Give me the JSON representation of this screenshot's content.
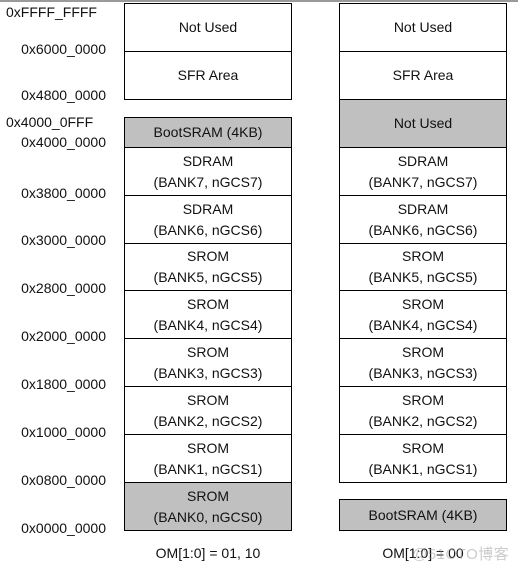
{
  "addresses": [
    "0xFFFF_FFFF",
    "0x6000_0000",
    "0x4800_0000",
    "0x4000_0FFF",
    "0x4000_0000",
    "0x3800_0000",
    "0x3000_0000",
    "0x2800_0000",
    "0x2000_0000",
    "0x1800_0000",
    "0x1000_0000",
    "0x0800_0000",
    "0x0000_0000"
  ],
  "left_map": {
    "caption": "OM[1:0] = 01, 10",
    "regions": [
      {
        "line1": "Not Used",
        "line2": "",
        "shaded": false
      },
      {
        "line1": "SFR Area",
        "line2": "",
        "shaded": false
      },
      {
        "line1": "BootSRAM (4KB)",
        "line2": "",
        "shaded": true
      },
      {
        "line1": "SDRAM",
        "line2": "(BANK7, nGCS7)",
        "shaded": false
      },
      {
        "line1": "SDRAM",
        "line2": "(BANK6, nGCS6)",
        "shaded": false
      },
      {
        "line1": "SROM",
        "line2": "(BANK5, nGCS5)",
        "shaded": false
      },
      {
        "line1": "SROM",
        "line2": "(BANK4, nGCS4)",
        "shaded": false
      },
      {
        "line1": "SROM",
        "line2": "(BANK3, nGCS3)",
        "shaded": false
      },
      {
        "line1": "SROM",
        "line2": "(BANK2, nGCS2)",
        "shaded": false
      },
      {
        "line1": "SROM",
        "line2": "(BANK1, nGCS1)",
        "shaded": false
      },
      {
        "line1": "SROM",
        "line2": "(BANK0, nGCS0)",
        "shaded": true
      }
    ]
  },
  "right_map": {
    "caption": "OM[1:0] = 00",
    "regions": [
      {
        "line1": "Not Used",
        "line2": "",
        "shaded": false
      },
      {
        "line1": "SFR Area",
        "line2": "",
        "shaded": false
      },
      {
        "line1": "Not Used",
        "line2": "",
        "shaded": true
      },
      {
        "line1": "SDRAM",
        "line2": "(BANK7, nGCS7)",
        "shaded": false
      },
      {
        "line1": "SDRAM",
        "line2": "(BANK6, nGCS6)",
        "shaded": false
      },
      {
        "line1": "SROM",
        "line2": "(BANK5, nGCS5)",
        "shaded": false
      },
      {
        "line1": "SROM",
        "line2": "(BANK4, nGCS4)",
        "shaded": false
      },
      {
        "line1": "SROM",
        "line2": "(BANK3, nGCS3)",
        "shaded": false
      },
      {
        "line1": "SROM",
        "line2": "(BANK2, nGCS2)",
        "shaded": false
      },
      {
        "line1": "SROM",
        "line2": "(BANK1, nGCS1)",
        "shaded": false
      },
      {
        "line1": "BootSRAM (4KB)",
        "line2": "",
        "shaded": true
      }
    ]
  },
  "watermark": "@51CTO博客",
  "colors": {
    "shaded": "#c0c0c0",
    "border": "#000000"
  }
}
